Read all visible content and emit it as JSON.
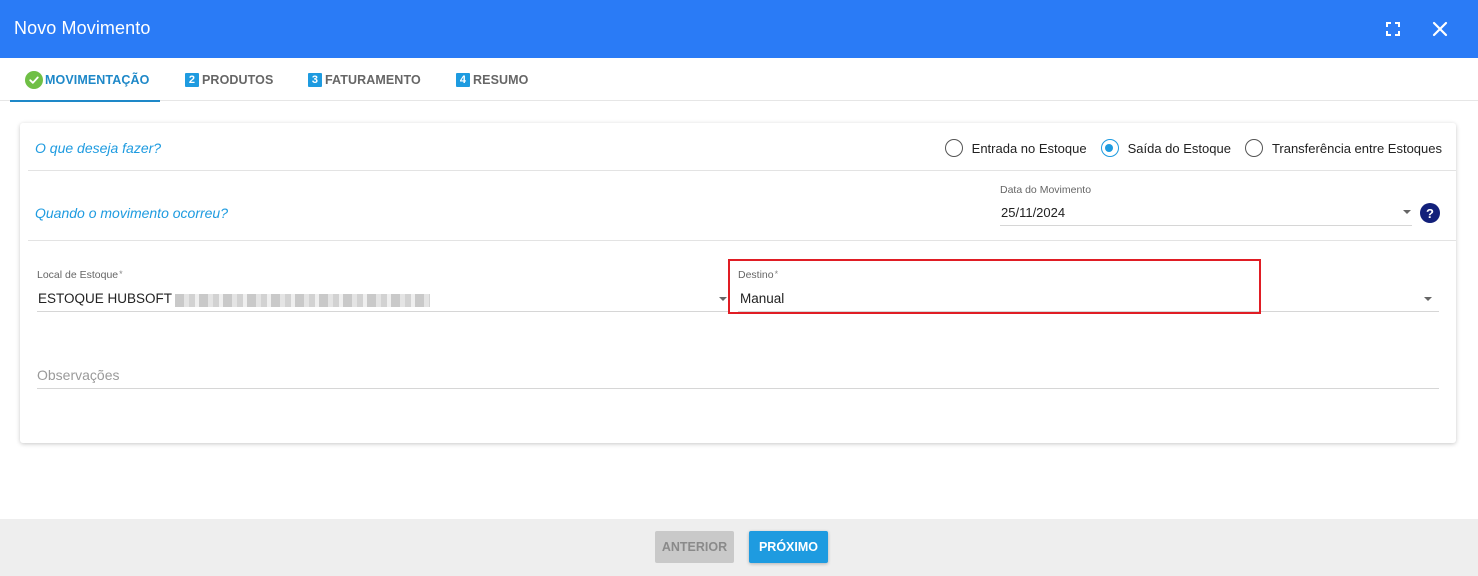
{
  "dialog": {
    "title": "Novo Movimento",
    "icons": {
      "fullscreen": "fullscreen-icon",
      "close": "close-icon"
    }
  },
  "tabs": [
    {
      "number": "",
      "label": "MOVIMENTAÇÃO",
      "state": "completed",
      "icon": "check-circle-icon"
    },
    {
      "number": "2",
      "label": "PRODUTOS",
      "state": "pending"
    },
    {
      "number": "3",
      "label": "FATURAMENTO",
      "state": "pending"
    },
    {
      "number": "4",
      "label": "RESUMO",
      "state": "pending"
    }
  ],
  "form": {
    "question_action": "O que deseja fazer?",
    "movement_types": [
      {
        "label": "Entrada no Estoque",
        "checked": false
      },
      {
        "label": "Saída do Estoque",
        "checked": true
      },
      {
        "label": "Transferência entre Estoques",
        "checked": false
      }
    ],
    "question_when": "Quando o movimento ocorreu?",
    "date_field": {
      "label": "Data do Movimento",
      "value": "25/11/2024"
    },
    "stock_location": {
      "label": "Local de Estoque",
      "required_mark": "*",
      "value": "ESTOQUE HUBSOFT -"
    },
    "destination": {
      "label": "Destino",
      "required_mark": "*",
      "value": "Manual"
    },
    "notes": {
      "placeholder": "Observações"
    }
  },
  "footer": {
    "previous_label": "ANTERIOR",
    "next_label": "PRÓXIMO"
  },
  "colors": {
    "header": "#2a7bf6",
    "accent": "#1e9be0",
    "highlight": "#e01d24",
    "completed": "#6fbf45"
  }
}
